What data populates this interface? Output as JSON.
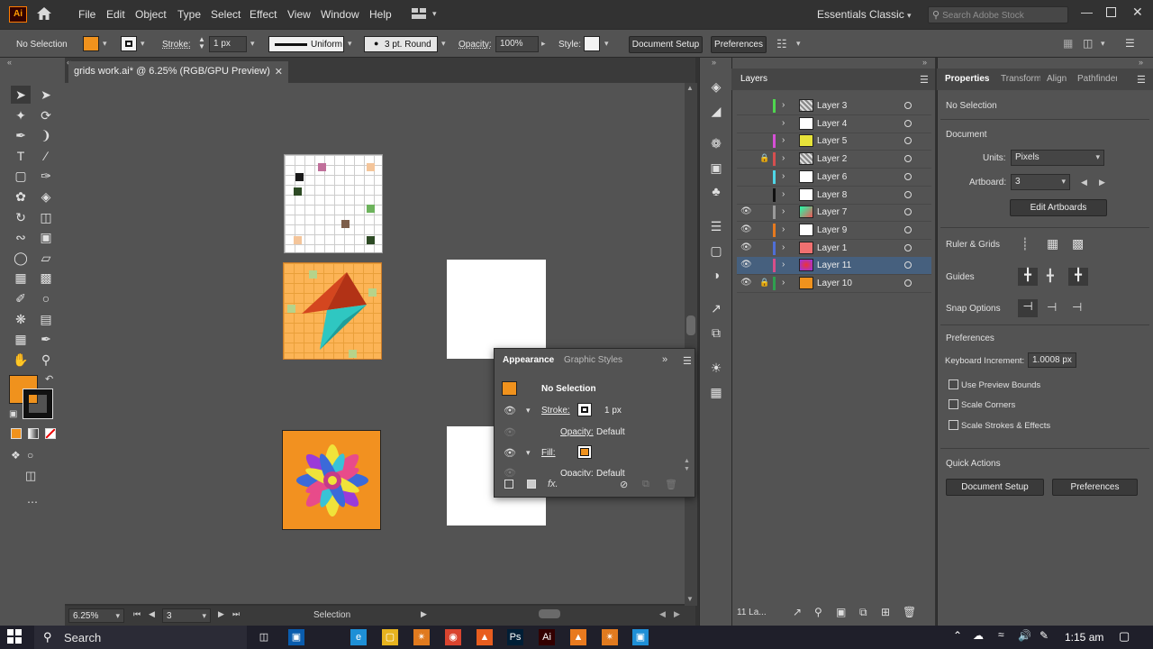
{
  "menu": {
    "logo": "Ai",
    "items": [
      "File",
      "Edit",
      "Object",
      "Type",
      "Select",
      "Effect",
      "View",
      "Window",
      "Help"
    ],
    "workspace": "Essentials Classic",
    "search_placeholder": "Search Adobe Stock"
  },
  "control": {
    "selection": "No Selection",
    "stroke_label": "Stroke:",
    "stroke_value": "1 px",
    "profile": "Uniform",
    "brush": "3 pt. Round",
    "opacity_label": "Opacity:",
    "opacity_value": "100%",
    "style_label": "Style:",
    "document_setup": "Document Setup",
    "preferences": "Preferences"
  },
  "document": {
    "tab_title": "grids work.ai* @ 6.25% (RGB/GPU Preview)",
    "zoom": "6.25%",
    "artboard": "3",
    "status": "Selection"
  },
  "layers": {
    "title": "Layers",
    "footer": "11 La...",
    "items": [
      {
        "name": "Layer 3",
        "color": "#4fd64f",
        "visible": false,
        "locked": false
      },
      {
        "name": "Layer 4",
        "color": "",
        "visible": false,
        "locked": false
      },
      {
        "name": "Layer 5",
        "color": "#d64fd6",
        "visible": false,
        "locked": false
      },
      {
        "name": "Layer 2",
        "color": "#d64f4f",
        "visible": false,
        "locked": true
      },
      {
        "name": "Layer 6",
        "color": "#4fd6e6",
        "visible": false,
        "locked": false
      },
      {
        "name": "Layer 8",
        "color": "#111111",
        "visible": false,
        "locked": false
      },
      {
        "name": "Layer 7",
        "color": "#9a9a9a",
        "visible": true,
        "locked": false
      },
      {
        "name": "Layer 9",
        "color": "#e67a1f",
        "visible": true,
        "locked": false
      },
      {
        "name": "Layer 1",
        "color": "#4f6fd6",
        "visible": true,
        "locked": false
      },
      {
        "name": "Layer 11",
        "color": "#d64f8a",
        "visible": true,
        "locked": false
      },
      {
        "name": "Layer 10",
        "color": "#2fa04f",
        "visible": true,
        "locked": true
      }
    ]
  },
  "properties": {
    "tabs": [
      "Properties",
      "Transform",
      "Align",
      "Pathfinder"
    ],
    "selection": "No Selection",
    "document_heading": "Document",
    "units_label": "Units:",
    "units_value": "Pixels",
    "artboard_label": "Artboard:",
    "artboard_value": "3",
    "edit_artboards": "Edit Artboards",
    "ruler_grids": "Ruler & Grids",
    "guides": "Guides",
    "snap_options": "Snap Options",
    "preferences_heading": "Preferences",
    "keyboard_increment_label": "Keyboard Increment:",
    "keyboard_increment_value": "1.0008 px",
    "use_preview_bounds": "Use Preview Bounds",
    "scale_corners": "Scale Corners",
    "scale_strokes": "Scale Strokes & Effects",
    "quick_actions": "Quick Actions",
    "document_setup": "Document Setup",
    "preferences": "Preferences"
  },
  "appearance": {
    "tabs": [
      "Appearance",
      "Graphic Styles"
    ],
    "selection": "No Selection",
    "stroke_label": "Stroke:",
    "stroke_value": "1 px",
    "opacity_label": "Opacity:",
    "opacity_value": "Default",
    "fill_label": "Fill:",
    "opacity2_value": "Default",
    "fx": "fx."
  },
  "taskbar": {
    "search": "Search",
    "time": "1:15 am"
  },
  "colors": {
    "fill": "#f0921d",
    "accent_selection": "#46607e"
  }
}
